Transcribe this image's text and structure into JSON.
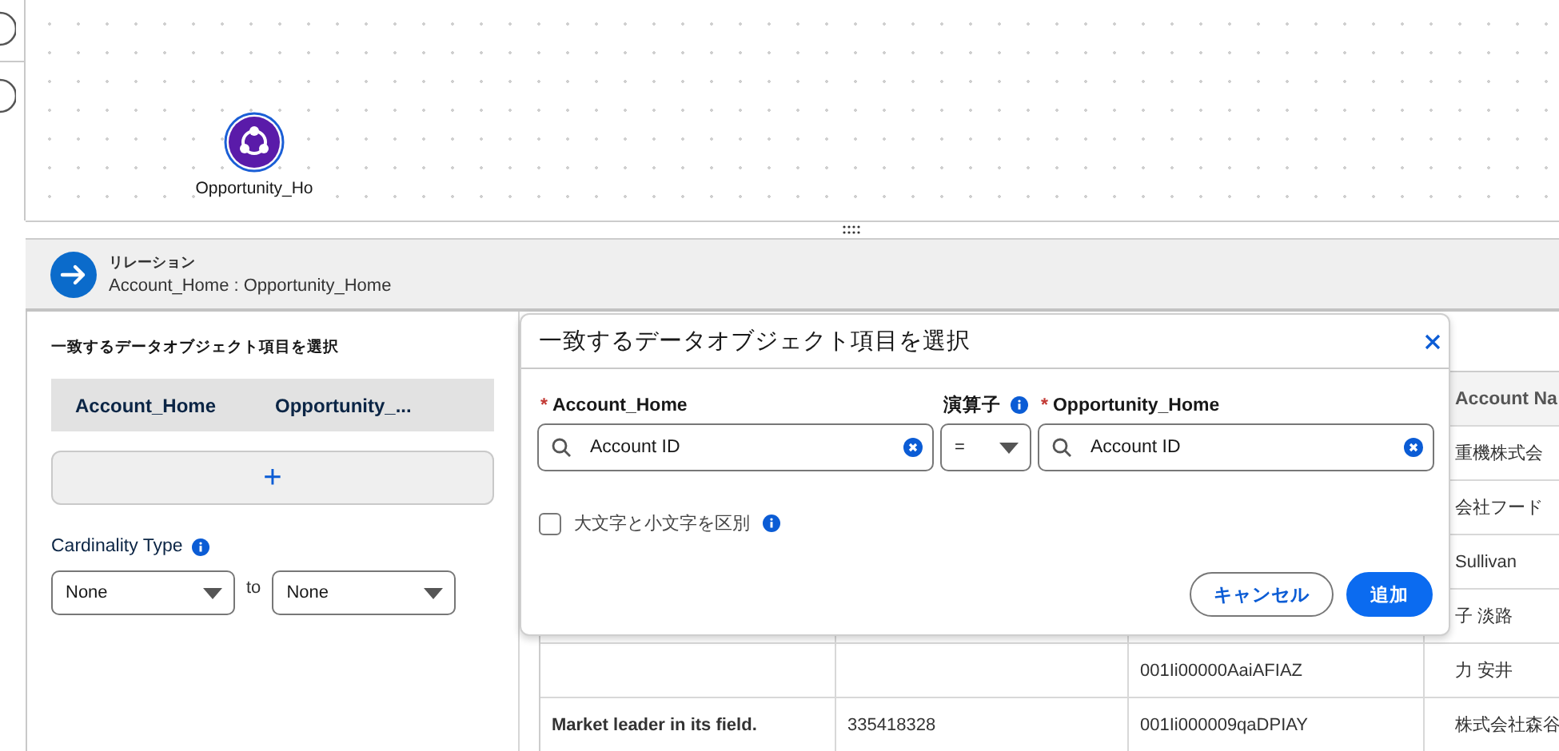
{
  "canvas": {
    "node": {
      "label": "Opportunity_Ho"
    }
  },
  "relation": {
    "title": "リレーション",
    "subtitle": "Account_Home : Opportunity_Home"
  },
  "mapping_panel": {
    "title": "一致するデータオブジェクト項目を選択",
    "columns": [
      "Account_Home",
      "Opportunity_..."
    ],
    "add_button": "+",
    "cardinality": {
      "label": "Cardinality Type",
      "from": "None",
      "separator": "to",
      "to": "None"
    }
  },
  "table": {
    "column_4_heading": "Account Na",
    "rows": [
      {
        "column_4": "重機株式会"
      },
      {
        "column_4": "会社フード"
      },
      {
        "column_4": "Sullivan"
      },
      {
        "column_4": "子 淡路"
      },
      {
        "column_3": "001Ii00000AaiAFIAZ",
        "column_4": "力 安井"
      },
      {
        "column_1": "Market leader in its field.",
        "column_2": "335418328",
        "column_3": "001Ii000009qaDPIAY",
        "column_4": "株式会社森谷"
      },
      {}
    ]
  },
  "dialog": {
    "title": "一致するデータオブジェクト項目を選択",
    "left_field": {
      "marker": "*",
      "label": "Account_Home",
      "value": "Account ID"
    },
    "operator": {
      "label": "演算子",
      "value": "="
    },
    "right_field": {
      "marker": "*",
      "label": "Opportunity_Home",
      "value": "Account ID"
    },
    "case_sensitive": {
      "label": "大文字と小文字を区別",
      "checked": false
    },
    "buttons": [
      {
        "label": "キャンセル",
        "kind": "neutral"
      },
      {
        "label": "追加",
        "kind": "brand"
      }
    ]
  }
}
